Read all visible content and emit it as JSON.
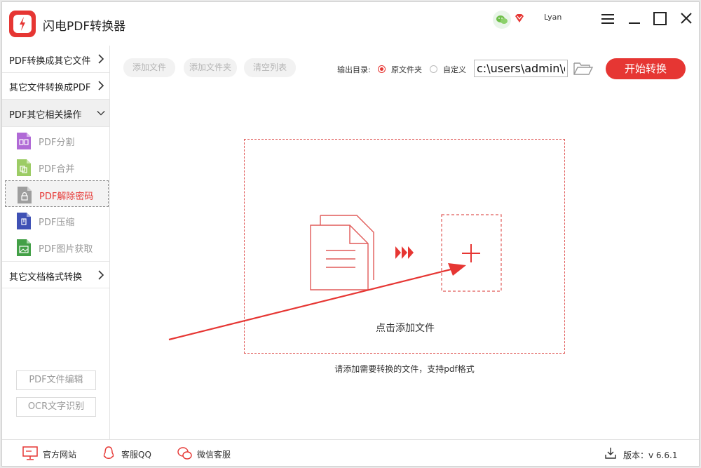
{
  "app": {
    "title": "闪电PDF转换器",
    "username": "Lyan"
  },
  "sidebar": {
    "items": [
      {
        "label": "PDF转换成其它文件"
      },
      {
        "label": "其它文件转换成PDF"
      },
      {
        "label": "PDF其它相关操作"
      },
      {
        "label": "其它文档格式转换"
      }
    ],
    "subitems": [
      {
        "label": "PDF分割",
        "icon": "pdf-split-icon",
        "color": "#b06ad6"
      },
      {
        "label": "PDF合并",
        "icon": "pdf-merge-icon",
        "color": "#9ccc65"
      },
      {
        "label": "PDF解除密码",
        "icon": "pdf-unlock-icon",
        "color": "#9e9e9e"
      },
      {
        "label": "PDF压缩",
        "icon": "pdf-compress-icon",
        "color": "#3f51b5"
      },
      {
        "label": "PDF图片获取",
        "icon": "pdf-image-icon",
        "color": "#43a047"
      }
    ],
    "bottom_buttons": [
      {
        "label": "PDF文件编辑"
      },
      {
        "label": "OCR文字识别"
      }
    ]
  },
  "toolbar": {
    "add_file": "添加文件",
    "add_folder": "添加文件夹",
    "clear_list": "清空列表",
    "output_label": "输出目录:",
    "radio_original": "原文件夹",
    "radio_custom": "自定义",
    "selected": "原文件夹",
    "path_value": "c:\\users\\admin\\d",
    "start": "开始转换"
  },
  "dropzone": {
    "label": "点击添加文件",
    "hint": "请添加需要转换的文件，支持pdf格式"
  },
  "footer": {
    "website": "官方网站",
    "qq": "客服QQ",
    "wechat": "微信客服",
    "version": "版本：v 6.6.1"
  },
  "colors": {
    "accent": "#e63633",
    "text": "#222222",
    "disabled": "#b5b5b5"
  }
}
